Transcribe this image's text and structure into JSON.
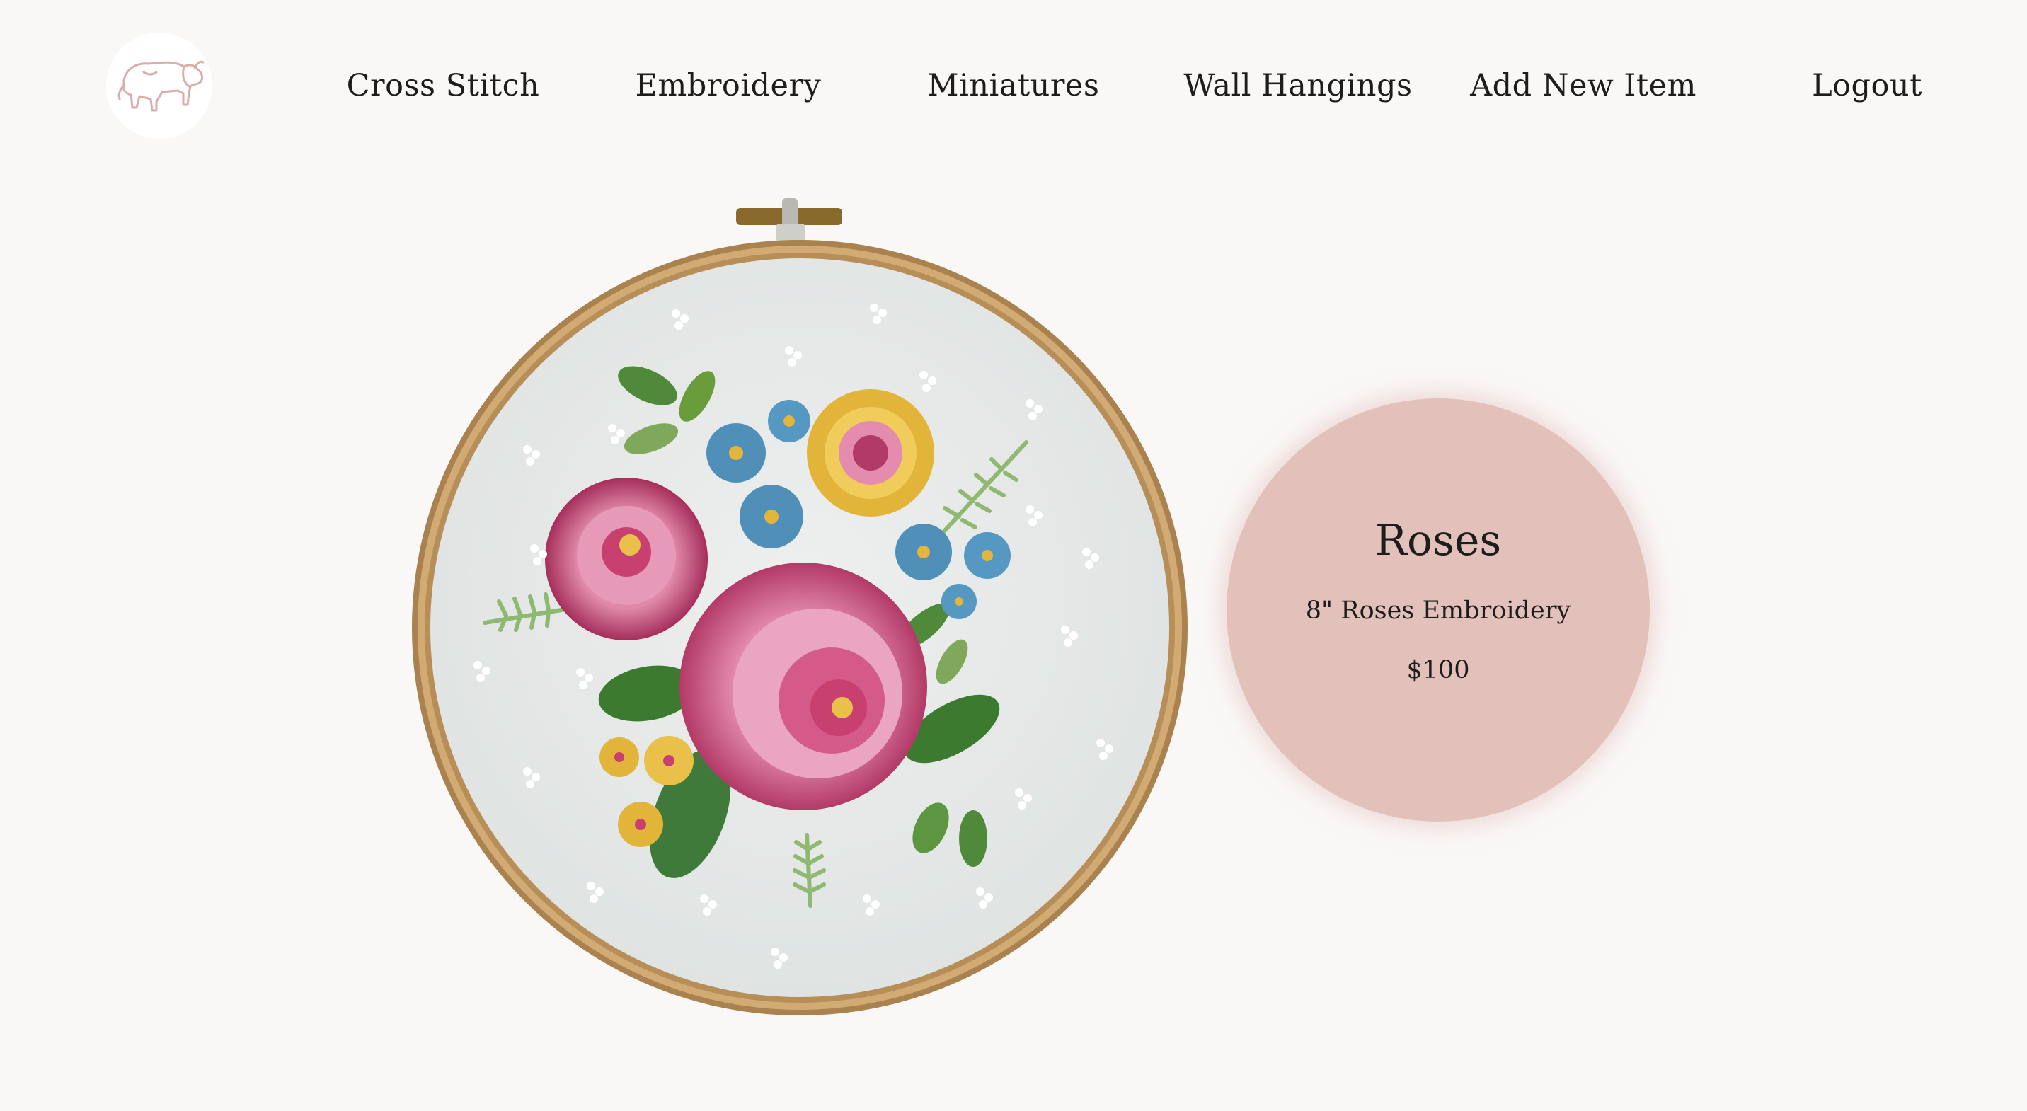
{
  "nav": {
    "logo_icon": "bison-icon",
    "links": [
      "Cross Stitch",
      "Embroidery",
      "Miniatures",
      "Wall Hangings",
      "Add New Item",
      "Logout"
    ]
  },
  "item": {
    "image_subject": "embroidery-hoop-roses",
    "title": "Roses",
    "description": "8\" Roses Embroidery",
    "price": "$100"
  },
  "colors": {
    "background": "#faf8f7",
    "info_circle": "#e3c1bb",
    "logo_line": "#d9aeaa",
    "text": "#1f1c1c"
  }
}
